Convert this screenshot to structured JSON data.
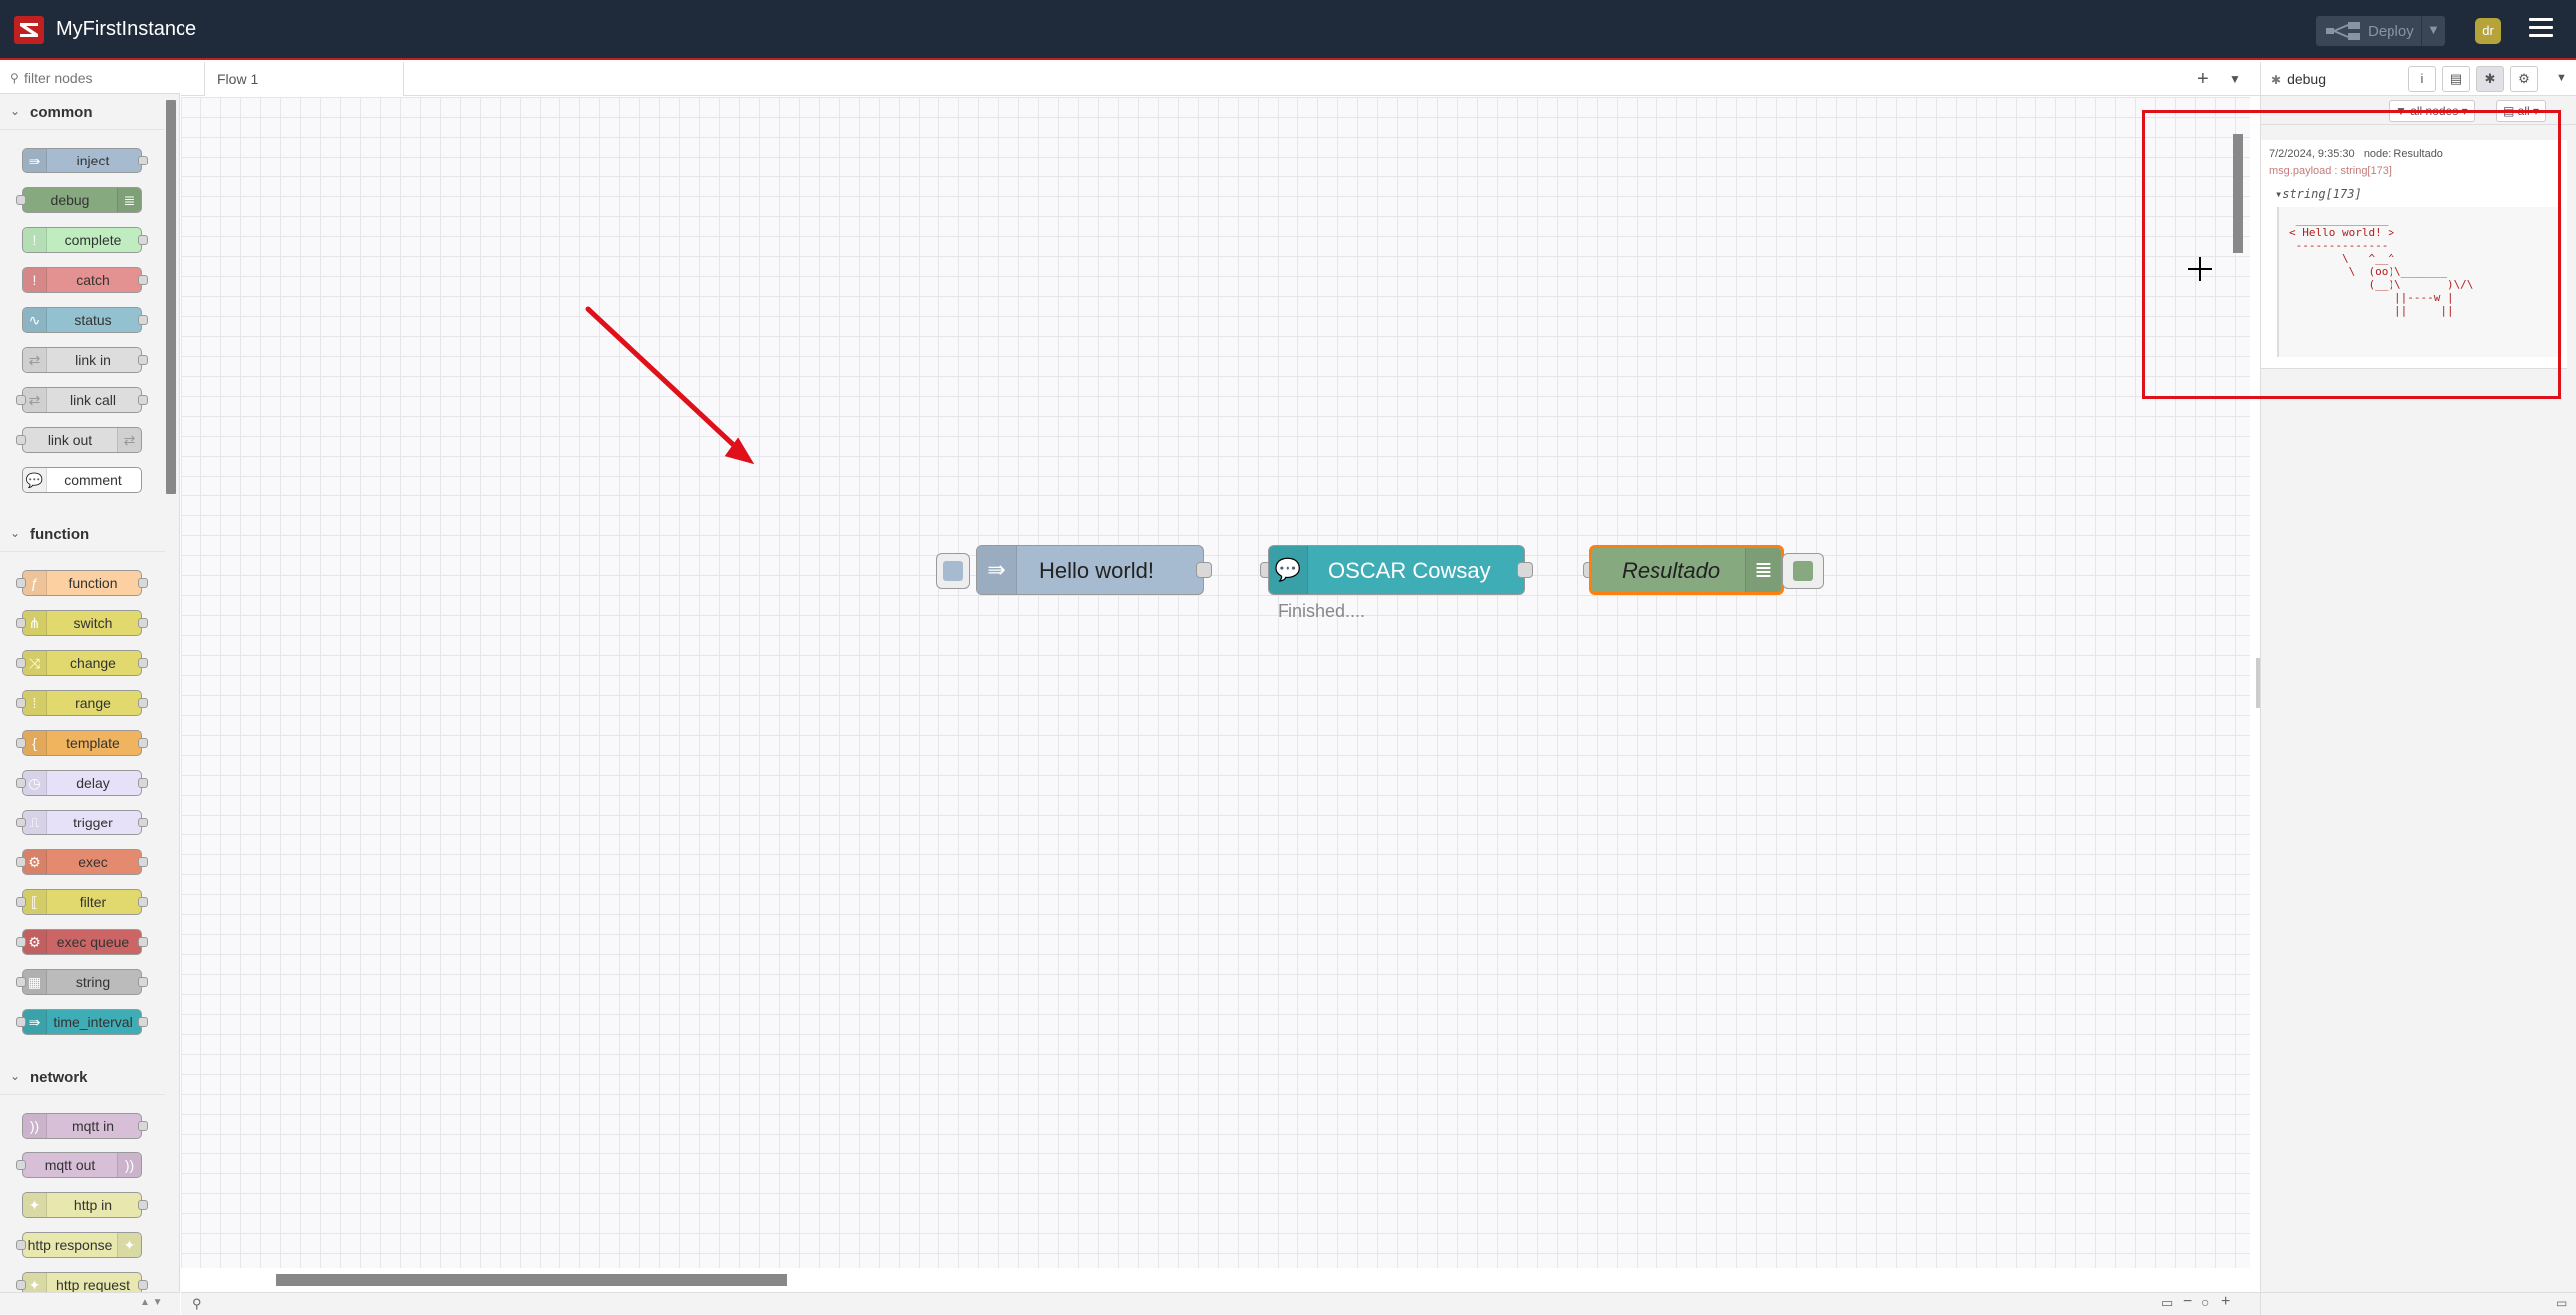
{
  "header": {
    "app_title": "MyFirstInstance",
    "deploy_label": "Deploy",
    "avatar_initials": "dr",
    "bg_color": "#1f2b3a",
    "accent_color": "#c02020"
  },
  "palette": {
    "filter_placeholder": "filter nodes",
    "categories": [
      {
        "name": "common",
        "nodes": [
          {
            "label": "inject",
            "color": "#a6bbcf",
            "icon": "arrow-right-icon"
          },
          {
            "label": "debug",
            "color": "#87a980",
            "icon": "list-icon"
          },
          {
            "label": "complete",
            "color": "#c0edc0",
            "icon": "exclamation-icon"
          },
          {
            "label": "catch",
            "color": "#e49191",
            "icon": "exclamation-icon"
          },
          {
            "label": "status",
            "color": "#94c1d0",
            "icon": "pulse-icon"
          },
          {
            "label": "link in",
            "color": "#dddddd",
            "icon": "link-icon"
          },
          {
            "label": "link call",
            "color": "#dddddd",
            "icon": "link-icon"
          },
          {
            "label": "link out",
            "color": "#dddddd",
            "icon": "link-icon"
          },
          {
            "label": "comment",
            "color": "#ffffff",
            "icon": "comment-icon"
          }
        ]
      },
      {
        "name": "function",
        "nodes": [
          {
            "label": "function",
            "color": "#fdd0a2",
            "icon": "function-icon"
          },
          {
            "label": "switch",
            "color": "#e2d96e",
            "icon": "switch-icon"
          },
          {
            "label": "change",
            "color": "#e2d96e",
            "icon": "shuffle-icon"
          },
          {
            "label": "range",
            "color": "#e2d96e",
            "icon": "range-icon"
          },
          {
            "label": "template",
            "color": "#f0b45f",
            "icon": "brace-icon"
          },
          {
            "label": "delay",
            "color": "#e6e0f8",
            "icon": "clock-icon"
          },
          {
            "label": "trigger",
            "color": "#e6e0f8",
            "icon": "trigger-icon"
          },
          {
            "label": "exec",
            "color": "#e48a6f",
            "icon": "gear-icon"
          },
          {
            "label": "filter",
            "color": "#e2d96e",
            "icon": "filter-icon"
          },
          {
            "label": "exec queue",
            "color": "#cc6666",
            "icon": "gear-icon"
          },
          {
            "label": "string",
            "color": "#bbbbbb",
            "icon": "string-icon"
          },
          {
            "label": "time_interval",
            "color": "#3fadb5",
            "icon": "arrow-right-icon"
          }
        ]
      },
      {
        "name": "network",
        "nodes": [
          {
            "label": "mqtt in",
            "color": "#d8bfd8",
            "icon": "wifi-icon"
          },
          {
            "label": "mqtt out",
            "color": "#d8bfd8",
            "icon": "wifi-icon"
          },
          {
            "label": "http in",
            "color": "#e7e7ae",
            "icon": "globe-icon"
          },
          {
            "label": "http response",
            "color": "#e7e7ae",
            "icon": "globe-icon"
          },
          {
            "label": "http request",
            "color": "#e7e7ae",
            "icon": "globe-icon"
          }
        ]
      }
    ]
  },
  "workspace": {
    "tab_label": "Flow 1",
    "nodes": {
      "inject": {
        "label": "Hello world!",
        "color": "#a6bbcf"
      },
      "cowsay": {
        "label": "OSCAR Cowsay",
        "color": "#3fadb5",
        "status": "Finished...."
      },
      "debug": {
        "label": "Resultado",
        "color": "#87a980",
        "selected_color": "#ff7f0e"
      }
    }
  },
  "sidebar": {
    "tab_label": "debug",
    "filter_nodes": "all nodes",
    "filter_level": "all",
    "message": {
      "timestamp": "7/2/2024, 9:35:30",
      "node": "node: Resultado",
      "path": "msg.payload : string[173]",
      "type": "string[173]",
      "value": " ______________\n< Hello world! >\n --------------\n        \\   ^__^\n         \\  (oo)\\_______\n            (__)\\       )\\/\\\n                ||----w |\n                ||     ||"
    }
  },
  "annotations": {
    "highlight_color": "#e0101a",
    "arrow_color": "#e0101a"
  }
}
